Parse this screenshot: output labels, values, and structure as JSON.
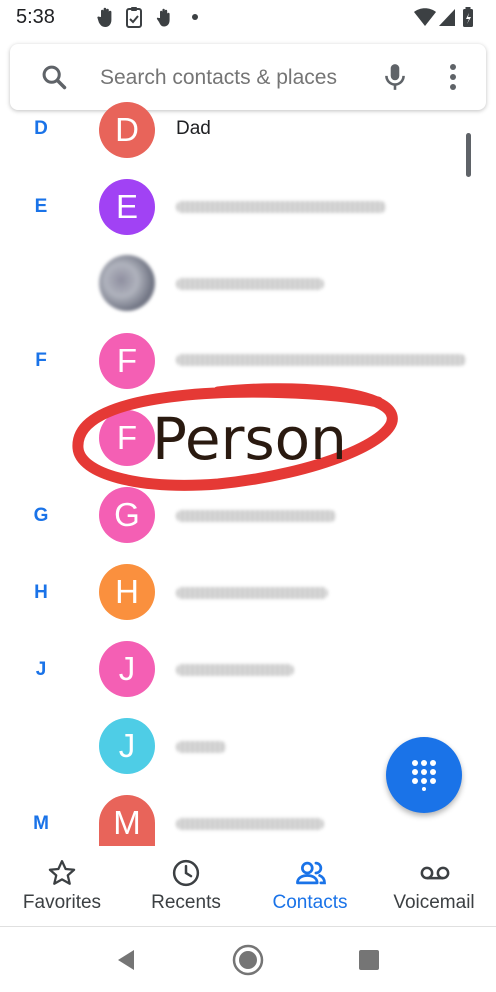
{
  "status_bar": {
    "time": "5:38"
  },
  "search": {
    "placeholder": "Search contacts & places"
  },
  "contacts": [
    {
      "section": "D",
      "initial": "D",
      "name": "Dad",
      "color": "#e8645a"
    },
    {
      "section": "E",
      "initial": "E",
      "color": "#a142f4"
    },
    {
      "section": "",
      "initial": "",
      "color": "#9e9e9e"
    },
    {
      "section": "F",
      "initial": "F",
      "color": "#f45fb4"
    },
    {
      "section": "",
      "initial": "F",
      "color": "#f45fb4"
    },
    {
      "section": "G",
      "initial": "G",
      "color": "#f45fb4"
    },
    {
      "section": "H",
      "initial": "H",
      "color": "#fa903e"
    },
    {
      "section": "J",
      "initial": "J",
      "color": "#f45fb4"
    },
    {
      "section": "",
      "initial": "J",
      "color": "#4ecde6"
    },
    {
      "section": "M",
      "initial": "M",
      "color": "#e8645a"
    }
  ],
  "annotation": {
    "text": "Person",
    "circle_color": "#e53935"
  },
  "bottom_nav": {
    "favorites": "Favorites",
    "recents": "Recents",
    "contacts": "Contacts",
    "voicemail": "Voicemail"
  },
  "icons": {
    "search": "search-icon",
    "mic": "mic-icon",
    "more": "more-vert-icon",
    "dialpad": "dialpad-icon",
    "star": "star-icon",
    "clock": "clock-icon",
    "people": "people-icon",
    "voicemail": "voicemail-icon"
  },
  "colors": {
    "accent": "#1a73e8"
  }
}
